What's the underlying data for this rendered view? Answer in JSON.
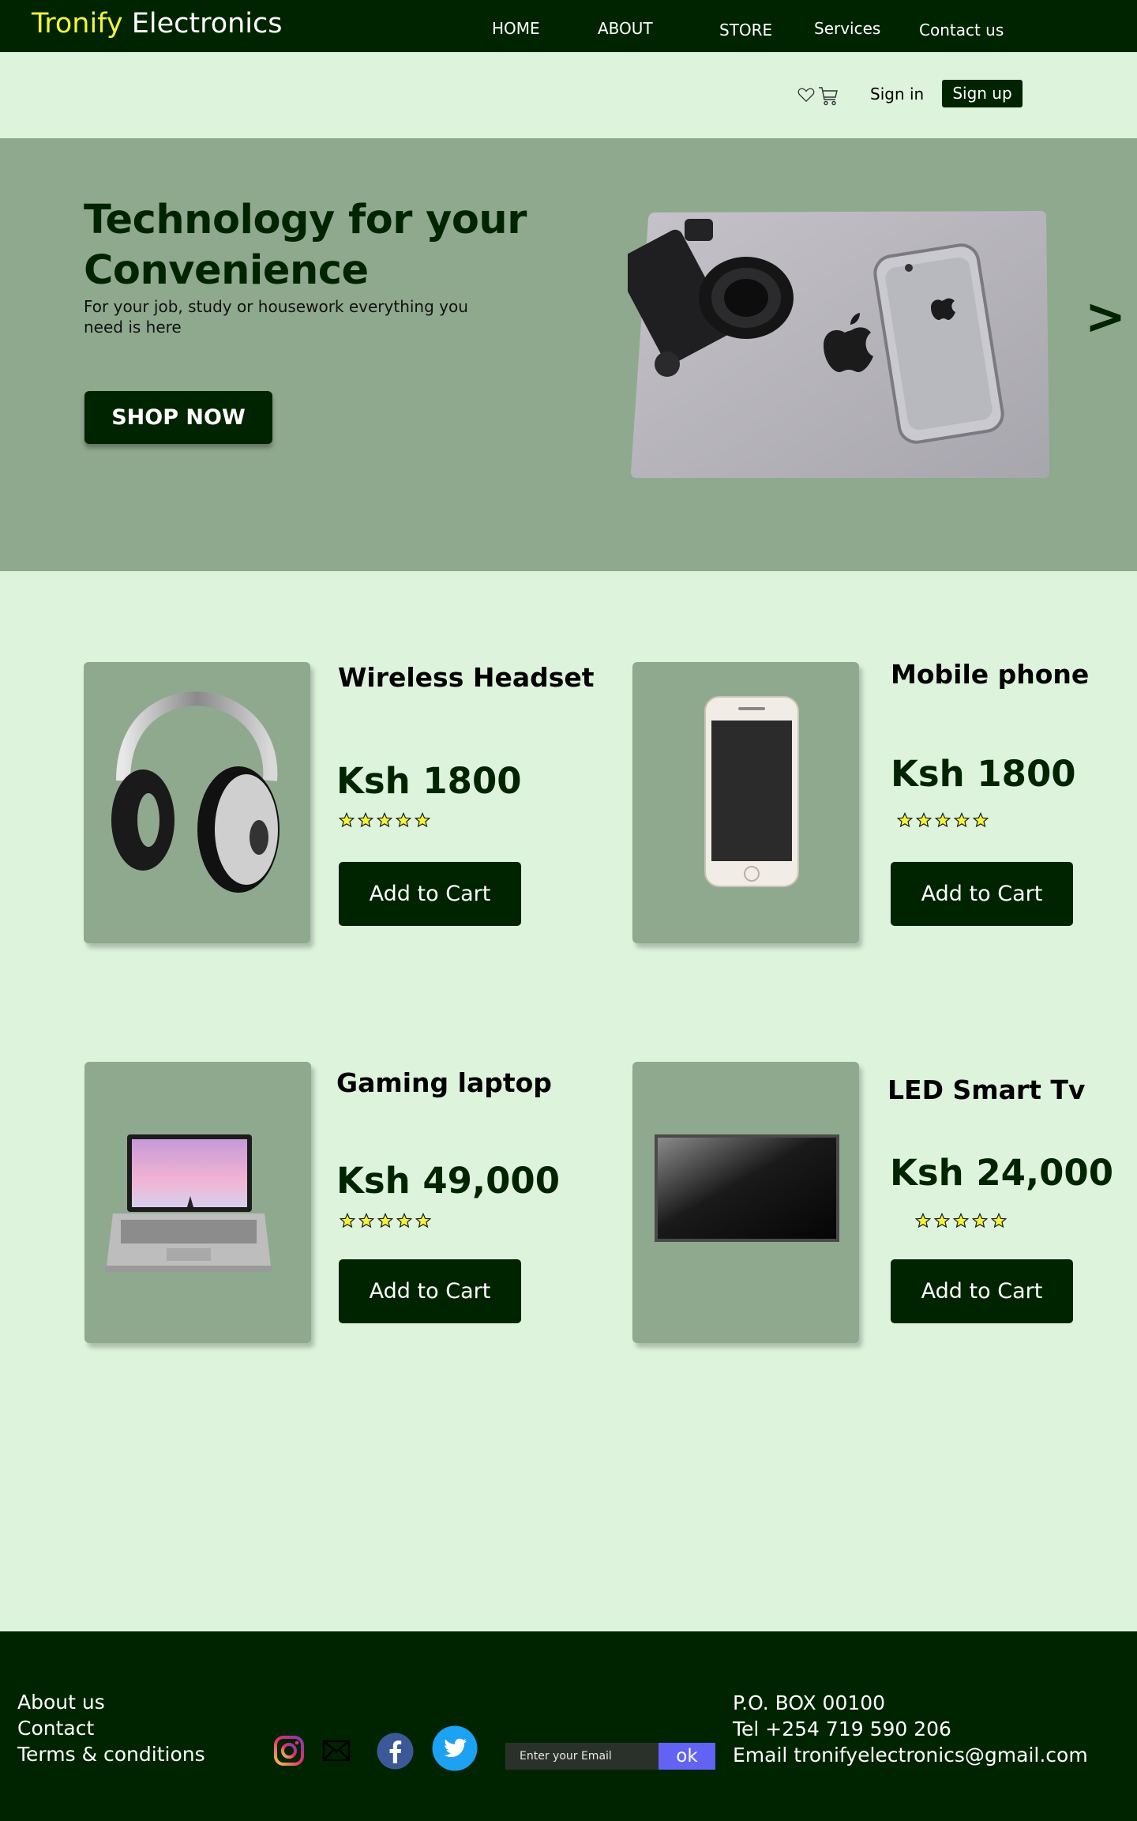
{
  "header": {
    "brand_first": "Tronify",
    "brand_second": "Electronics",
    "nav": [
      "HOME",
      "ABOUT",
      "STORE",
      "Services",
      "Contact us"
    ]
  },
  "account": {
    "sign_in": "Sign in",
    "sign_up": "Sign up",
    "icons": [
      "heart-icon",
      "cart-icon"
    ]
  },
  "hero": {
    "title": "Technology for your Convenience",
    "subtitle": "For your job, study or housework everything you need is here",
    "button": "SHOP NOW",
    "next": ">"
  },
  "products": [
    {
      "name": "Wireless Headset",
      "price": "Ksh 1800",
      "rating": 5,
      "button": "Add to Cart"
    },
    {
      "name": "Mobile phone",
      "price": "Ksh 1800",
      "rating": 5,
      "button": "Add to Cart"
    },
    {
      "name": "Gaming laptop",
      "price": "Ksh 49,000",
      "rating": 5,
      "button": "Add to Cart"
    },
    {
      "name": "LED Smart Tv",
      "price": "Ksh 24,000",
      "rating": 5,
      "button": "Add to Cart"
    }
  ],
  "footer": {
    "links": [
      "About us",
      "Contact",
      "Terms & conditions"
    ],
    "social": [
      "instagram-icon",
      "mail-icon",
      "facebook-icon",
      "twitter-icon"
    ],
    "email_placeholder": "Enter your Email",
    "ok": "ok",
    "contact": [
      "P.O. BOX 00100",
      "Tel +254 719 590 206",
      "Email tronifyelectronics@gmail.com"
    ]
  },
  "colors": {
    "primary": "#002400",
    "background": "#ddf3dc",
    "panel": "#8fa98e",
    "brand_accent": "#f2f43c",
    "ok_button": "#6262f5"
  }
}
